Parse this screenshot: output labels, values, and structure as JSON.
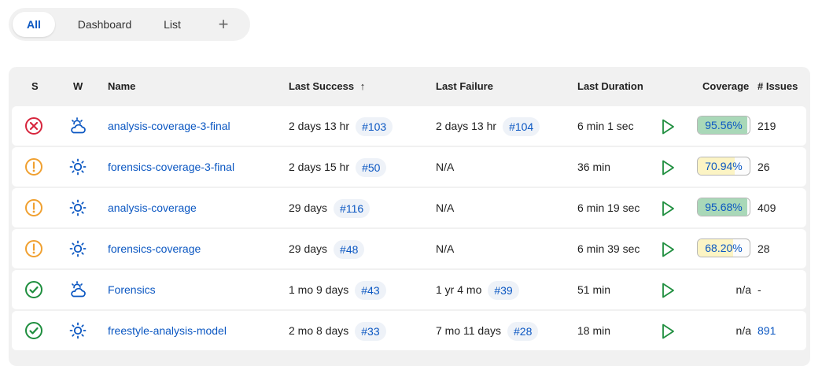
{
  "tabs": [
    {
      "label": "All",
      "active": true
    },
    {
      "label": "Dashboard",
      "active": false
    },
    {
      "label": "List",
      "active": false
    }
  ],
  "add_tab_label": "+",
  "headers": {
    "status": "S",
    "weather": "W",
    "name": "Name",
    "last_success": "Last Success",
    "sort_indicator": "↑",
    "last_failure": "Last Failure",
    "last_duration": "Last Duration",
    "coverage": "Coverage",
    "issues": "# Issues"
  },
  "colors": {
    "link": "#0b57c2",
    "status_failed": "#d7263d",
    "status_unstable": "#f0a030",
    "status_success": "#1e8e3e",
    "coverage_high": "#a9d8b8",
    "coverage_mid": "#fcf4c4",
    "run_button": "#1e8e3e"
  },
  "jobs": [
    {
      "status_icon": "failed-status-icon",
      "weather_icon": "cloudy-weather-icon",
      "name": "analysis-coverage-3-final",
      "last_success": "2 days 13 hr",
      "last_success_build": "#103",
      "last_failure": "2 days 13 hr",
      "last_failure_build": "#104",
      "last_duration": "6 min 1 sec",
      "coverage": "95.56%",
      "coverage_value": 95.56,
      "coverage_level": "high",
      "issues": "219",
      "issues_link": false
    },
    {
      "status_icon": "unstable-status-icon",
      "weather_icon": "sunny-weather-icon",
      "name": "forensics-coverage-3-final",
      "last_success": "2 days 15 hr",
      "last_success_build": "#50",
      "last_failure": "N/A",
      "last_failure_build": "",
      "last_duration": "36 min",
      "coverage": "70.94%",
      "coverage_value": 70.94,
      "coverage_level": "mid",
      "issues": "26",
      "issues_link": false
    },
    {
      "status_icon": "unstable-status-icon",
      "weather_icon": "sunny-weather-icon",
      "name": "analysis-coverage",
      "last_success": "29 days",
      "last_success_build": "#116",
      "last_failure": "N/A",
      "last_failure_build": "",
      "last_duration": "6 min 19 sec",
      "coverage": "95.68%",
      "coverage_value": 95.68,
      "coverage_level": "high",
      "issues": "409",
      "issues_link": false
    },
    {
      "status_icon": "unstable-status-icon",
      "weather_icon": "sunny-weather-icon",
      "name": "forensics-coverage",
      "last_success": "29 days",
      "last_success_build": "#48",
      "last_failure": "N/A",
      "last_failure_build": "",
      "last_duration": "6 min 39 sec",
      "coverage": "68.20%",
      "coverage_value": 68.2,
      "coverage_level": "mid",
      "issues": "28",
      "issues_link": false
    },
    {
      "status_icon": "success-status-icon",
      "weather_icon": "cloudy-weather-icon",
      "name": "Forensics",
      "last_success": "1 mo 9 days",
      "last_success_build": "#43",
      "last_failure": "1 yr 4 mo",
      "last_failure_build": "#39",
      "last_duration": "51 min",
      "coverage": "n/a",
      "coverage_value": null,
      "coverage_level": "none",
      "issues": "-",
      "issues_link": false
    },
    {
      "status_icon": "success-status-icon",
      "weather_icon": "sunny-weather-icon",
      "name": "freestyle-analysis-model",
      "last_success": "2 mo 8 days",
      "last_success_build": "#33",
      "last_failure": "7 mo 11 days",
      "last_failure_build": "#28",
      "last_duration": "18 min",
      "coverage": "n/a",
      "coverage_value": null,
      "coverage_level": "none",
      "issues": "891",
      "issues_link": true
    }
  ]
}
